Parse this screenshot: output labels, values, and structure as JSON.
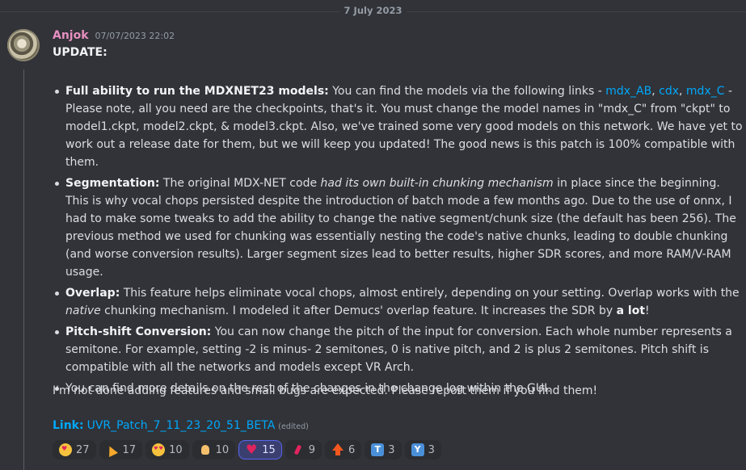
{
  "date_divider": "7 July 2023",
  "author": {
    "name": "Anjok",
    "timestamp": "07/07/2023 22:02"
  },
  "update_title": "UPDATE:",
  "bullets": [
    {
      "title": "Full ability to run the MDXNET23 models:",
      "text_a": " You can find the models via the following links  - ",
      "links": [
        "mdx_AB",
        "cdx",
        "mdx_C"
      ],
      "sep": ", ",
      "text_b": " - Please note, all you need are the checkpoints, that's it. You must change the model names in \"mdx_C\" from \"ckpt\" to model1.ckpt, model2.ckpt, & model3.ckpt. Also, we've trained some very good models on this network. We have yet to work out a release date for them, but we will keep you updated! The good news is this patch is 100% compatible with them."
    },
    {
      "title": "Segmentation:",
      "text_a": " The original MDX-NET code ",
      "italic": "had its own built-in chunking mechanism",
      "text_b": " in place since the beginning. This is why vocal chops persisted despite the introduction of batch mode a few months ago. Due to the use of onnx, I had to make some tweaks to add the ability to change the native segment/chunk size (the default has been 256). The previous method we used for chunking was essentially nesting the code's native chunks, leading to double chunking (and worse conversion results). Larger segment sizes lead to better results, higher SDR scores, and more RAM/V-RAM usage."
    },
    {
      "title": "Overlap:",
      "text_a": " This feature helps eliminate vocal chops, almost entirely, depending on your setting. Overlap works with the ",
      "italic": "native",
      "text_b": " chunking mechanism. I modeled it after Demucs' overlap feature. It increases the SDR by ",
      "bold_end": "a lot",
      "text_c": "!"
    },
    {
      "title": "Pitch-shift Conversion:",
      "text_a": " You can now change the pitch of the input for conversion. Each whole number represents a semitone. For example, setting -2 is minus- 2 semitones, 0 is native pitch, and 2 is plus 2 semitones. Pitch shift is compatible with all the networks and models except VR Arch."
    },
    {
      "text_a": "You can find more details on the rest of the changes in the change log within the GUI."
    }
  ],
  "closing": "I'm not done adding features and small bugs are expected. Please report them if you find them!",
  "link_label": "Link:",
  "link_text": "UVR_Patch_7_11_23_20_51_BETA",
  "edited": "(edited)",
  "reactions": [
    {
      "icon": "smiling-face-with-hearts-icon",
      "count": "27",
      "active": false
    },
    {
      "icon": "party-popper-icon",
      "count": "17",
      "active": false
    },
    {
      "icon": "heart-eyes-icon",
      "count": "10",
      "active": false
    },
    {
      "icon": "raised-hands-icon",
      "count": "10",
      "active": false
    },
    {
      "icon": "red-heart-icon",
      "count": "15",
      "active": true
    },
    {
      "icon": "confetti-icon",
      "count": "9",
      "active": false
    },
    {
      "icon": "up-arrow-icon",
      "count": "6",
      "active": false
    },
    {
      "icon": "letter-t-icon",
      "count": "3",
      "active": false,
      "letter": "T"
    },
    {
      "icon": "letter-y-icon",
      "count": "3",
      "active": false,
      "letter": "Y"
    }
  ]
}
